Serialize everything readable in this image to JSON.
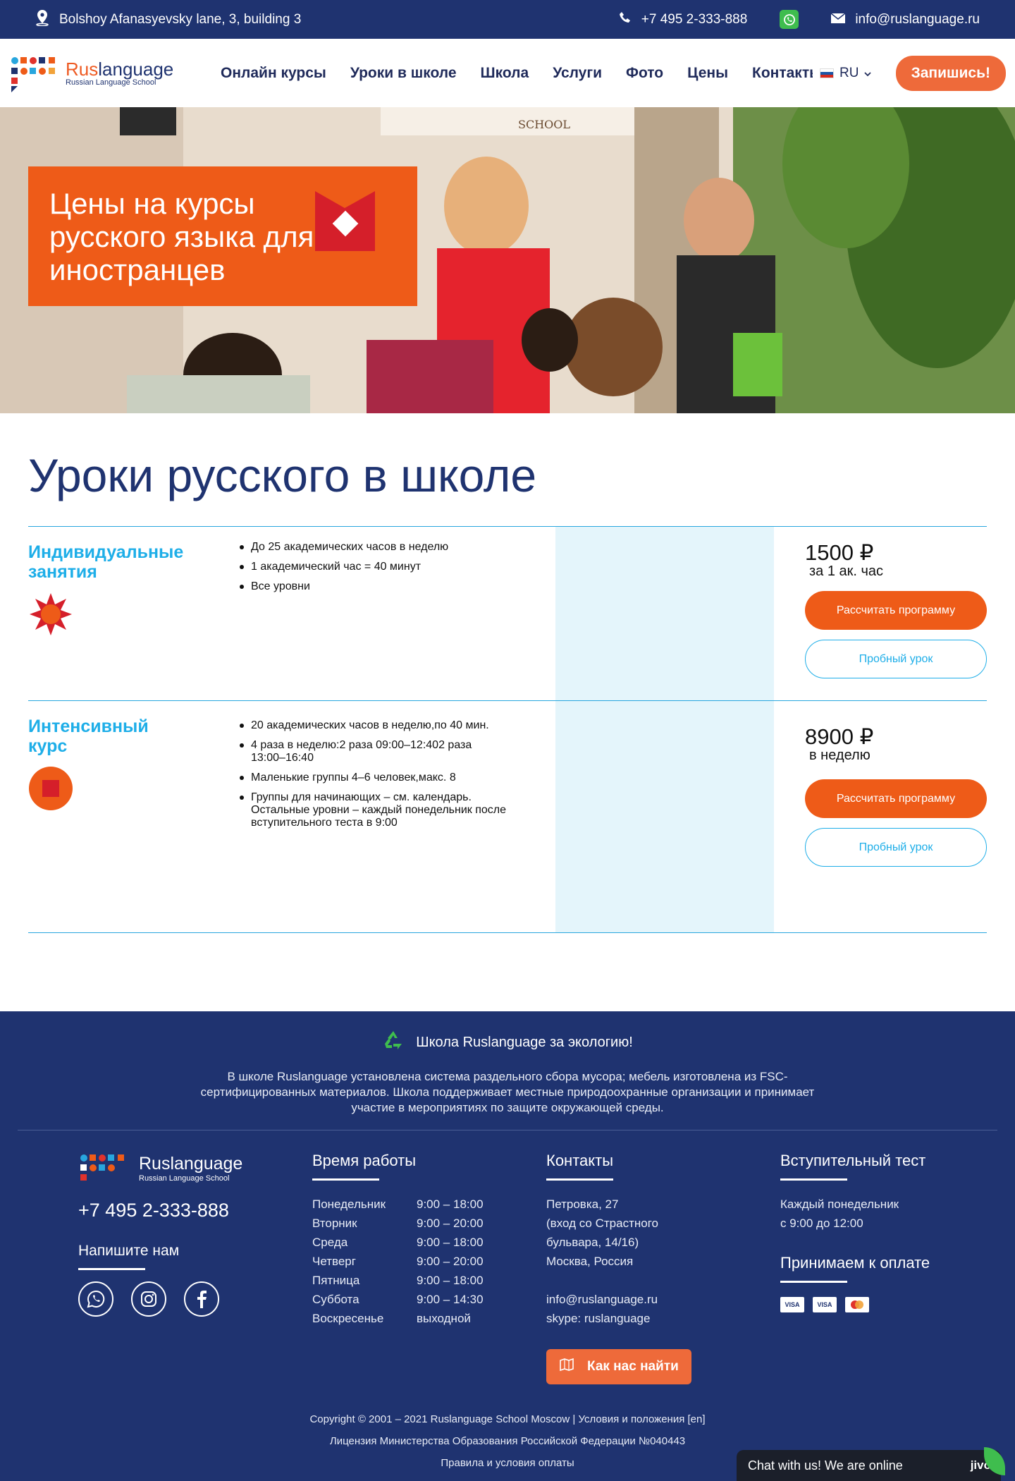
{
  "topbar": {
    "address": "Bolshoy Afanasyevsky lane, 3, building 3",
    "phone": "+7 495 2-333-888",
    "email": "info@ruslanguage.ru"
  },
  "header": {
    "logo_brand_part1": "Rus",
    "logo_brand_part2": "language",
    "logo_sub": "Russian Language School",
    "nav": [
      "Онлайн курсы",
      "Уроки в школе",
      "Школа",
      "Услуги",
      "Фото",
      "Цены",
      "Контакты"
    ],
    "lang": "RU",
    "cta": "Запишись!"
  },
  "hero": {
    "title": "Цены на курсы русского языка для иностранцев"
  },
  "section": {
    "title": "Уроки русского в школе",
    "rows": [
      {
        "title": "Индивидуальные занятия",
        "items": [
          "До 25 академических часов в неделю",
          "1 академический час = 40 минут",
          "Все уровни"
        ],
        "price": "1500 ₽",
        "per": "за 1 ак. час",
        "btn_primary": "Рассчитать программу",
        "btn_outline": "Пробный урок"
      },
      {
        "title": "Интенсивный курс",
        "items": [
          "20 академических часов в неделю,по 40 мин.",
          "4 раза в неделю:2 раза 09:00–12:402 раза 13:00–16:40",
          "Маленькие группы 4–6 человек,макс. 8",
          "Группы для начинающих – см. календарь. Остальные уровни – каждый понедельник после вступительного теста в 9:00"
        ],
        "price": "8900 ₽",
        "per": "в неделю",
        "btn_primary": "Рассчитать программу",
        "btn_outline": "Пробный урок"
      }
    ]
  },
  "footer": {
    "eco_title": "Школа Ruslanguage за экологию!",
    "eco_text": "В школе Ruslanguage установлена система раздельного сбора мусора; мебель изготовлена из FSC-сертифицированных материалов. Школа поддерживает местные природоохранные организации и принимает участие в мероприятиях по защите окружающей среды.",
    "logo_brand": "Ruslanguage",
    "logo_sub": "Russian Language School",
    "phone": "+7 495 2-333-888",
    "write_us": "Напишите нам",
    "hours_title": "Время работы",
    "hours": [
      {
        "day": "Понедельник",
        "time": "9:00 – 18:00"
      },
      {
        "day": "Вторник",
        "time": "9:00 – 20:00"
      },
      {
        "day": "Среда",
        "time": "9:00 – 18:00"
      },
      {
        "day": "Четверг",
        "time": "9:00 – 20:00"
      },
      {
        "day": "Пятница",
        "time": "9:00 – 18:00"
      },
      {
        "day": "Суббота",
        "time": "9:00 – 14:30"
      },
      {
        "day": "Воскресенье",
        "time": "выходной"
      }
    ],
    "contacts_title": "Контакты",
    "contacts": [
      "Петровка, 27",
      "(вход со Страстного",
      "бульвара, 14/16)",
      "Москва, Россия"
    ],
    "contact_email": "info@ruslanguage.ru",
    "contact_skype": "skype: ruslanguage",
    "find_us": "Как нас найти",
    "test_title": "Вступительный тест",
    "test_lines": [
      "Каждый понедельник",
      "с 9:00 до 12:00"
    ],
    "pay_title": "Принимаем к оплате",
    "cards": [
      "VISA",
      "VISA",
      "MC"
    ],
    "legal": [
      "Copyright © 2001 – 2021 Ruslanguage School Moscow | Условия и положения [en]",
      "Лицензия Министерства Образования Российской Федерации №040443",
      "Правила и условия оплаты"
    ]
  },
  "chat": {
    "label": "Chat with us! We are online",
    "brand": "jivo"
  },
  "colors": {
    "navy": "#1f3370",
    "orange": "#ee5b18",
    "blue": "#1eaee8",
    "stripe": "#e4f5fb"
  }
}
